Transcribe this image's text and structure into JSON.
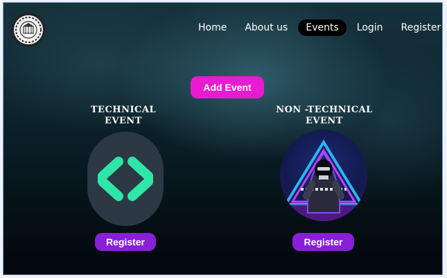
{
  "nav": {
    "items": [
      {
        "label": "Home",
        "active": false
      },
      {
        "label": "About us",
        "active": false
      },
      {
        "label": "Events",
        "active": true
      },
      {
        "label": "Login",
        "active": false
      },
      {
        "label": "Register",
        "active": false
      }
    ]
  },
  "actions": {
    "add_event_label": "Add Event"
  },
  "events": [
    {
      "title_line1": "TECHNICAL",
      "title_line2": "EVENT",
      "image_icon": "code-brackets-icon",
      "register_label": "Register"
    },
    {
      "title_line1": "NON -TECHNICAL",
      "title_line2": "EVENT",
      "image_icon": "hooded-gamer-icon",
      "register_label": "Register"
    }
  ],
  "colors": {
    "add_button": "#e81bd2",
    "register_button": "#8a1fd8",
    "active_nav_bg": "#000000",
    "code_icon": "#2ee6a8"
  }
}
